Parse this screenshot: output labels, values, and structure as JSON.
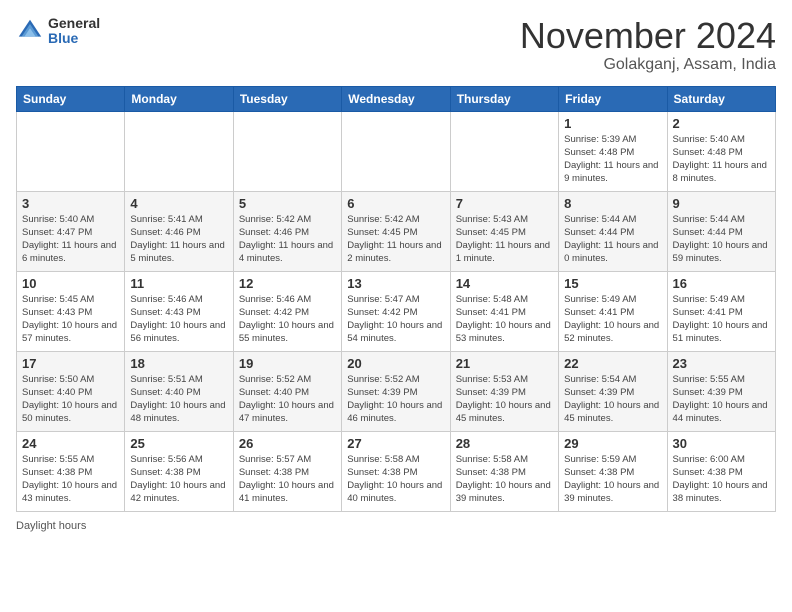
{
  "header": {
    "logo_general": "General",
    "logo_blue": "Blue",
    "month": "November 2024",
    "location": "Golakganj, Assam, India"
  },
  "days_of_week": [
    "Sunday",
    "Monday",
    "Tuesday",
    "Wednesday",
    "Thursday",
    "Friday",
    "Saturday"
  ],
  "weeks": [
    [
      {
        "num": "",
        "info": ""
      },
      {
        "num": "",
        "info": ""
      },
      {
        "num": "",
        "info": ""
      },
      {
        "num": "",
        "info": ""
      },
      {
        "num": "",
        "info": ""
      },
      {
        "num": "1",
        "info": "Sunrise: 5:39 AM\nSunset: 4:48 PM\nDaylight: 11 hours and 9 minutes."
      },
      {
        "num": "2",
        "info": "Sunrise: 5:40 AM\nSunset: 4:48 PM\nDaylight: 11 hours and 8 minutes."
      }
    ],
    [
      {
        "num": "3",
        "info": "Sunrise: 5:40 AM\nSunset: 4:47 PM\nDaylight: 11 hours and 6 minutes."
      },
      {
        "num": "4",
        "info": "Sunrise: 5:41 AM\nSunset: 4:46 PM\nDaylight: 11 hours and 5 minutes."
      },
      {
        "num": "5",
        "info": "Sunrise: 5:42 AM\nSunset: 4:46 PM\nDaylight: 11 hours and 4 minutes."
      },
      {
        "num": "6",
        "info": "Sunrise: 5:42 AM\nSunset: 4:45 PM\nDaylight: 11 hours and 2 minutes."
      },
      {
        "num": "7",
        "info": "Sunrise: 5:43 AM\nSunset: 4:45 PM\nDaylight: 11 hours and 1 minute."
      },
      {
        "num": "8",
        "info": "Sunrise: 5:44 AM\nSunset: 4:44 PM\nDaylight: 11 hours and 0 minutes."
      },
      {
        "num": "9",
        "info": "Sunrise: 5:44 AM\nSunset: 4:44 PM\nDaylight: 10 hours and 59 minutes."
      }
    ],
    [
      {
        "num": "10",
        "info": "Sunrise: 5:45 AM\nSunset: 4:43 PM\nDaylight: 10 hours and 57 minutes."
      },
      {
        "num": "11",
        "info": "Sunrise: 5:46 AM\nSunset: 4:43 PM\nDaylight: 10 hours and 56 minutes."
      },
      {
        "num": "12",
        "info": "Sunrise: 5:46 AM\nSunset: 4:42 PM\nDaylight: 10 hours and 55 minutes."
      },
      {
        "num": "13",
        "info": "Sunrise: 5:47 AM\nSunset: 4:42 PM\nDaylight: 10 hours and 54 minutes."
      },
      {
        "num": "14",
        "info": "Sunrise: 5:48 AM\nSunset: 4:41 PM\nDaylight: 10 hours and 53 minutes."
      },
      {
        "num": "15",
        "info": "Sunrise: 5:49 AM\nSunset: 4:41 PM\nDaylight: 10 hours and 52 minutes."
      },
      {
        "num": "16",
        "info": "Sunrise: 5:49 AM\nSunset: 4:41 PM\nDaylight: 10 hours and 51 minutes."
      }
    ],
    [
      {
        "num": "17",
        "info": "Sunrise: 5:50 AM\nSunset: 4:40 PM\nDaylight: 10 hours and 50 minutes."
      },
      {
        "num": "18",
        "info": "Sunrise: 5:51 AM\nSunset: 4:40 PM\nDaylight: 10 hours and 48 minutes."
      },
      {
        "num": "19",
        "info": "Sunrise: 5:52 AM\nSunset: 4:40 PM\nDaylight: 10 hours and 47 minutes."
      },
      {
        "num": "20",
        "info": "Sunrise: 5:52 AM\nSunset: 4:39 PM\nDaylight: 10 hours and 46 minutes."
      },
      {
        "num": "21",
        "info": "Sunrise: 5:53 AM\nSunset: 4:39 PM\nDaylight: 10 hours and 45 minutes."
      },
      {
        "num": "22",
        "info": "Sunrise: 5:54 AM\nSunset: 4:39 PM\nDaylight: 10 hours and 45 minutes."
      },
      {
        "num": "23",
        "info": "Sunrise: 5:55 AM\nSunset: 4:39 PM\nDaylight: 10 hours and 44 minutes."
      }
    ],
    [
      {
        "num": "24",
        "info": "Sunrise: 5:55 AM\nSunset: 4:38 PM\nDaylight: 10 hours and 43 minutes."
      },
      {
        "num": "25",
        "info": "Sunrise: 5:56 AM\nSunset: 4:38 PM\nDaylight: 10 hours and 42 minutes."
      },
      {
        "num": "26",
        "info": "Sunrise: 5:57 AM\nSunset: 4:38 PM\nDaylight: 10 hours and 41 minutes."
      },
      {
        "num": "27",
        "info": "Sunrise: 5:58 AM\nSunset: 4:38 PM\nDaylight: 10 hours and 40 minutes."
      },
      {
        "num": "28",
        "info": "Sunrise: 5:58 AM\nSunset: 4:38 PM\nDaylight: 10 hours and 39 minutes."
      },
      {
        "num": "29",
        "info": "Sunrise: 5:59 AM\nSunset: 4:38 PM\nDaylight: 10 hours and 39 minutes."
      },
      {
        "num": "30",
        "info": "Sunrise: 6:00 AM\nSunset: 4:38 PM\nDaylight: 10 hours and 38 minutes."
      }
    ]
  ],
  "footer": {
    "label": "Daylight hours"
  }
}
